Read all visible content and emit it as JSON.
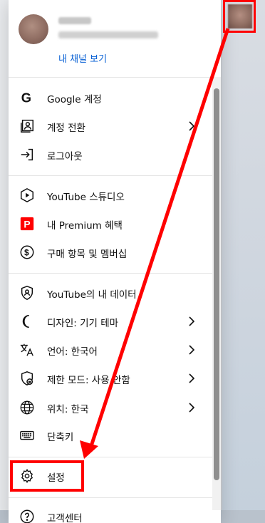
{
  "header": {
    "channel_link": "내 채널 보기"
  },
  "menu_items": [
    {
      "label": "Google 계정",
      "icon": "google-icon",
      "chevron": false
    },
    {
      "label": "계정 전환",
      "icon": "switch-account-icon",
      "chevron": true
    },
    {
      "label": "로그아웃",
      "icon": "sign-out-icon",
      "chevron": false
    },
    {
      "label": "YouTube 스튜디오",
      "icon": "youtube-studio-icon",
      "chevron": false
    },
    {
      "label": "내 Premium 혜택",
      "icon": "premium-icon",
      "chevron": false
    },
    {
      "label": "구매 항목 및 멤버십",
      "icon": "dollar-icon",
      "chevron": false
    },
    {
      "label": "YouTube의 내 데이터",
      "icon": "shield-person-icon",
      "chevron": false
    },
    {
      "label": "디자인: 기기 테마",
      "icon": "moon-icon",
      "chevron": true
    },
    {
      "label": "언어: 한국어",
      "icon": "translate-icon",
      "chevron": true
    },
    {
      "label": "제한 모드: 사용 안함",
      "icon": "restricted-mode-icon",
      "chevron": true
    },
    {
      "label": "위치: 한국",
      "icon": "globe-icon",
      "chevron": true
    },
    {
      "label": "단축키",
      "icon": "keyboard-icon",
      "chevron": false
    },
    {
      "label": "설정",
      "icon": "gear-icon",
      "chevron": false
    },
    {
      "label": "고객센터",
      "icon": "help-icon",
      "chevron": false
    }
  ],
  "colors": {
    "link": "#065fd4",
    "annotation": "#ff0000",
    "premium": "#ff0000"
  }
}
